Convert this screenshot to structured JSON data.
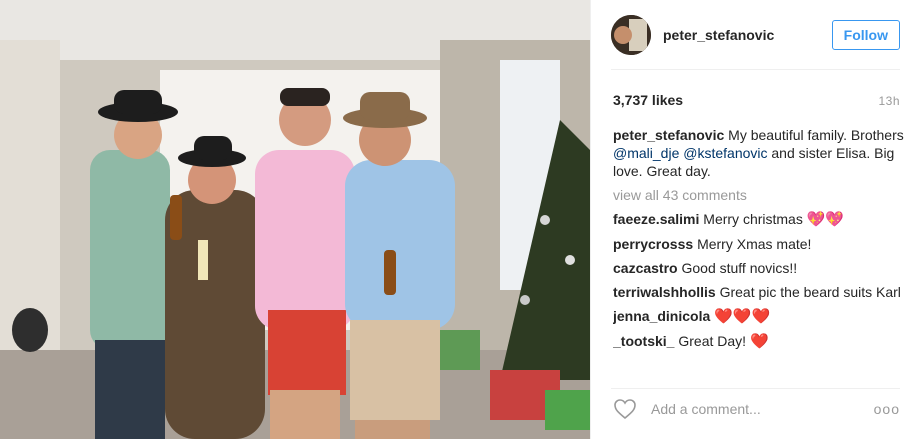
{
  "post": {
    "username": "peter_stefanovic",
    "follow_label": "Follow",
    "likes": "3,737 likes",
    "time": "13h",
    "caption": {
      "user": "peter_stefanovic",
      "text_1": "My beautiful family. Brothers",
      "mention_1": "@mali_dje",
      "mention_2": "@kstefanovic",
      "text_2": "and sister Elisa. Big love. Great day."
    },
    "view_all": "view all 43 comments",
    "comments": [
      {
        "user": "faeeze.salimi",
        "text": "Merry christmas",
        "emoji": "💖💖"
      },
      {
        "user": "perrycrosss",
        "text": "Merry Xmas mate!",
        "emoji": ""
      },
      {
        "user": "cazcastro",
        "text": "Good stuff novics!!",
        "emoji": ""
      },
      {
        "user": "terriwalshhollis",
        "text": "Great pic the beard suits Karl",
        "emoji": ""
      },
      {
        "user": "jenna_dinicola",
        "text": "",
        "emoji": "❤️❤️❤️"
      },
      {
        "user": "_tootski_",
        "text": "Great Day!",
        "emoji": "❤️"
      }
    ],
    "add_comment_placeholder": "Add a comment...",
    "more_label": "ooo",
    "colors": {
      "accent": "#3897f0",
      "mention": "#003569",
      "muted": "#999999"
    }
  }
}
